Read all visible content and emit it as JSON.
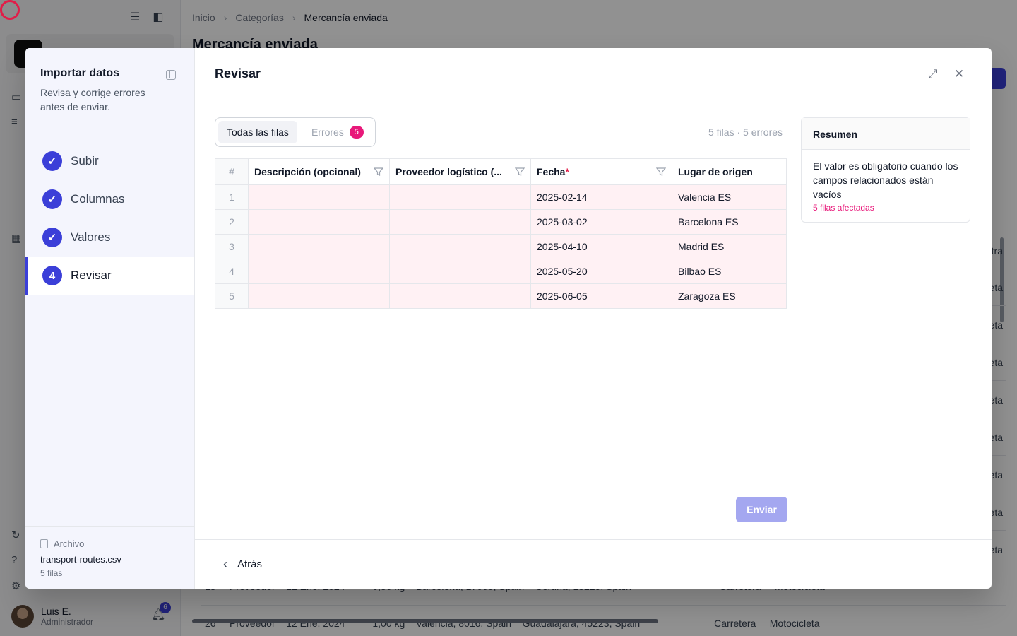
{
  "background": {
    "breadcrumb": [
      "Inicio",
      "Categorías",
      "Mercancía enviada"
    ],
    "page_title": "Mercancía enviada",
    "user": {
      "name": "Luis E.",
      "role": "Administrador",
      "notifications": "6"
    },
    "right_column_values": [
      "tra",
      "cleta",
      "cleta",
      "cleta",
      "cleta",
      "cleta",
      "cleta",
      "cleta",
      "cleta"
    ],
    "bottom_rows": [
      "15     Proveedor    12 Ene. 2024          0,50 kg    Barcelona, 17000, Spain    Coruña, 15229, Spain                                Carretera     Motocicleta",
      "26     Proveedor    12 Ene. 2024          1,00 kg    València, 8016, Spain    Guadalajara, 45223, Spain                           Carretera     Motocicleta"
    ]
  },
  "import": {
    "title": "Importar datos",
    "subtitle": "Revisa y corrige errores antes de enviar.",
    "steps": [
      {
        "label": "Subir",
        "state": "done"
      },
      {
        "label": "Columnas",
        "state": "done"
      },
      {
        "label": "Valores",
        "state": "done"
      },
      {
        "label": "Revisar",
        "state": "active",
        "number": "4"
      }
    ],
    "file": {
      "label": "Archivo",
      "name": "transport-routes.csv",
      "rows": "5 filas"
    }
  },
  "review": {
    "title": "Revisar",
    "tabs": {
      "all": "Todas las filas",
      "errors": "Errores",
      "errors_count": "5"
    },
    "row_count": "5 filas · 5 errores",
    "columns": {
      "index": "#",
      "description": "Descripción (opcional)",
      "provider": "Proveedor logístico (...",
      "date": "Fecha",
      "date_required": "*",
      "origin": "Lugar de origen"
    },
    "rows": [
      {
        "idx": "1",
        "description": "",
        "provider": "",
        "date": "2025-02-14",
        "origin": "Valencia ES"
      },
      {
        "idx": "2",
        "description": "",
        "provider": "",
        "date": "2025-03-02",
        "origin": "Barcelona ES"
      },
      {
        "idx": "3",
        "description": "",
        "provider": "",
        "date": "2025-04-10",
        "origin": "Madrid ES"
      },
      {
        "idx": "4",
        "description": "",
        "provider": "",
        "date": "2025-05-20",
        "origin": "Bilbao ES"
      },
      {
        "idx": "5",
        "description": "",
        "provider": "",
        "date": "2025-06-05",
        "origin": "Zaragoza ES"
      }
    ],
    "summary": {
      "title": "Resumen",
      "message": "El valor es obligatorio cuando los campos relacionados están vacíos",
      "affected": "5 filas afectadas"
    },
    "submit": "Enviar",
    "back": "Atrás"
  },
  "colors": {
    "accent": "#3b3fd8",
    "error": "#e8197a",
    "error_bg": "#fff1f4"
  },
  "icons": [
    "check-icon",
    "collapse-panel-icon",
    "expand-icon",
    "close-icon",
    "filter-icon",
    "chevron-left-icon",
    "file-icon",
    "bell-icon"
  ]
}
